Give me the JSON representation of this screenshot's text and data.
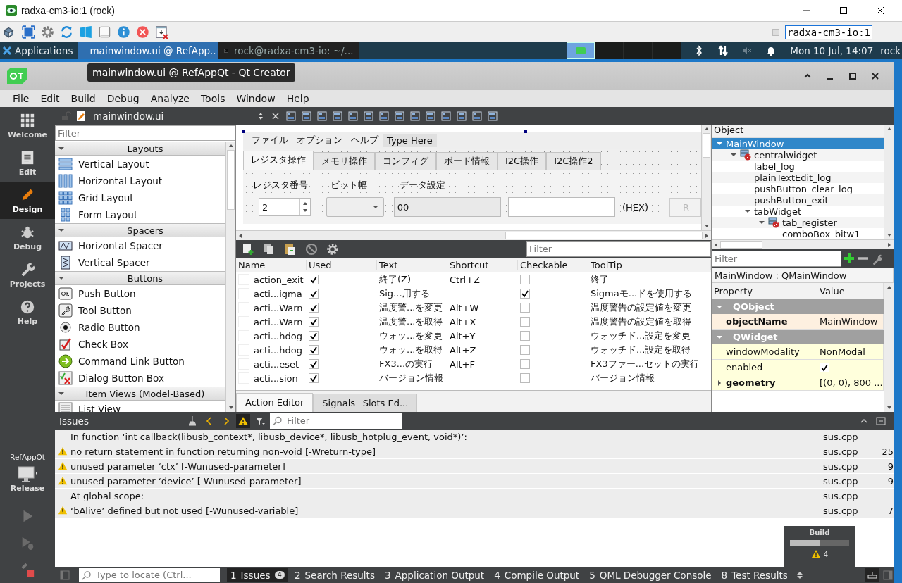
{
  "vnc": {
    "title": "radxa-cm3-io:1 (rock)",
    "host_field": "radxa-cm3-io:1"
  },
  "taskbar": {
    "applications": "Applications",
    "tasks": [
      {
        "label": "mainwindow.ui @ RefApp..",
        "kind": "qt",
        "selected": true
      },
      {
        "label": "rock@radxa-cm3-io: ~/...",
        "kind": "terminal",
        "selected": false
      }
    ],
    "clock": "Mon 10 Jul, 14:07",
    "user": "rock"
  },
  "tooltip": "mainwindow.ui @ RefAppQt - Qt Creator",
  "menu": [
    "File",
    "Edit",
    "Build",
    "Debug",
    "Analyze",
    "Tools",
    "Window",
    "Help"
  ],
  "modes": [
    {
      "label": "Welcome",
      "kind": "grid",
      "selected": false
    },
    {
      "label": "Edit",
      "kind": "doc",
      "selected": false
    },
    {
      "label": "Design",
      "kind": "pencil",
      "selected": true
    },
    {
      "label": "Debug",
      "kind": "bug",
      "selected": false
    },
    {
      "label": "Projects",
      "kind": "wrench",
      "selected": false
    },
    {
      "label": "Help",
      "kind": "help",
      "selected": false
    }
  ],
  "target": {
    "project": "RefAppQt",
    "config": "Release"
  },
  "editor": {
    "file": "mainwindow.ui"
  },
  "widget_box": {
    "placeholder": "Filter",
    "groups": [
      {
        "title": "Layouts",
        "items": [
          {
            "label": "Vertical Layout",
            "kind": "vlayout"
          },
          {
            "label": "Horizontal Layout",
            "kind": "hlayout"
          },
          {
            "label": "Grid Layout",
            "kind": "grid"
          },
          {
            "label": "Form Layout",
            "kind": "form"
          }
        ]
      },
      {
        "title": "Spacers",
        "items": [
          {
            "label": "Horizontal Spacer",
            "kind": "hspacer"
          },
          {
            "label": "Vertical Spacer",
            "kind": "vspacer"
          }
        ]
      },
      {
        "title": "Buttons",
        "items": [
          {
            "label": "Push Button",
            "kind": "push"
          },
          {
            "label": "Tool Button",
            "kind": "tool"
          },
          {
            "label": "Radio Button",
            "kind": "radio"
          },
          {
            "label": "Check Box",
            "kind": "check"
          },
          {
            "label": "Command Link Button",
            "kind": "command"
          },
          {
            "label": "Dialog Button Box",
            "kind": "dialog"
          }
        ]
      },
      {
        "title": "Item Views (Model-Based)",
        "items": [
          {
            "label": "List View",
            "kind": "list"
          }
        ]
      }
    ]
  },
  "form": {
    "menu": [
      {
        "label": "ファイル",
        "kind": "menu"
      },
      {
        "label": "オプション",
        "kind": "menu"
      },
      {
        "label": "ヘルプ",
        "kind": "menu"
      },
      {
        "label": "Type Here",
        "kind": "placeholder"
      }
    ],
    "tabs": [
      {
        "label": "レジスタ操作",
        "selected": true
      },
      {
        "label": "メモリ操作",
        "selected": false
      },
      {
        "label": "コンフィグ",
        "selected": false
      },
      {
        "label": "ボード情報",
        "selected": false
      },
      {
        "label": "I2C操作",
        "selected": false
      },
      {
        "label": "I2C操作2",
        "selected": false
      }
    ],
    "labels": [
      "レジスタ番号",
      "ビット幅",
      "データ設定"
    ],
    "spin_value": "2",
    "data_value": "00",
    "hex": "(HEX)",
    "button_label": "R"
  },
  "actions": {
    "placeholder": "Filter",
    "columns": [
      "Name",
      "Used",
      "Text",
      "Shortcut",
      "Checkable",
      "ToolTip"
    ],
    "rows": [
      {
        "name": "action_exit",
        "used": true,
        "text": "終了(Z)",
        "shortcut": "Ctrl+Z",
        "checkable": false,
        "tooltip": "終了"
      },
      {
        "name": "acti...igma",
        "used": true,
        "text": "Sig...用する",
        "checkable": true,
        "tooltip": "Sigmaモ...ドを使用する"
      },
      {
        "name": "acti...Warn",
        "used": true,
        "text": "温度警...を変更",
        "shortcut": "Alt+W",
        "checkable": false,
        "tooltip": "温度警告の設定値を変更"
      },
      {
        "name": "acti...Warn",
        "used": true,
        "text": "温度警...を取得",
        "shortcut": "Alt+X",
        "checkable": false,
        "tooltip": "温度警告の設定値を取得"
      },
      {
        "name": "acti...hdog",
        "used": true,
        "text": "ウォッ...を変更",
        "shortcut": "Alt+Y",
        "checkable": false,
        "tooltip": "ウォッチド...設定を変更"
      },
      {
        "name": "acti...hdog",
        "used": true,
        "text": "ウォッ...を取得",
        "shortcut": "Alt+Z",
        "checkable": false,
        "tooltip": "ウォッチド...設定を取得"
      },
      {
        "name": "acti...eset",
        "used": true,
        "text": "FX3...の実行",
        "shortcut": "Alt+F",
        "checkable": false,
        "tooltip": "FX3ファー...セットの実行"
      },
      {
        "name": "acti...sion",
        "used": true,
        "text": "バージョン情報",
        "checkable": false,
        "tooltip": "バージョン情報"
      }
    ],
    "tabs": [
      {
        "label": "Action Editor",
        "selected": true
      },
      {
        "label": "Signals _Slots Ed...",
        "selected": false
      }
    ]
  },
  "object_inspector": {
    "heading": "Object",
    "tree": [
      {
        "label": "MainWindow",
        "selected": true,
        "expanded": true,
        "children": [
          {
            "label": "centralwidget",
            "kind": "layout",
            "selected": false,
            "expanded": true,
            "children": [
              {
                "label": "label_log",
                "selected": false
              },
              {
                "label": "plainTextEdit_log",
                "selected": false
              },
              {
                "label": "pushButton_clear_log",
                "selected": false
              },
              {
                "label": "pushButton_exit",
                "selected": false
              },
              {
                "label": "tabWidget",
                "selected": false,
                "expanded": true,
                "children": [
                  {
                    "label": "tab_register",
                    "kind": "layout",
                    "selected": false,
                    "expanded": true,
                    "children": [
                      {
                        "label": "comboBox_bitw1",
                        "selected": false
                      }
                    ]
                  }
                ]
              }
            ]
          }
        ]
      }
    ]
  },
  "property_editor": {
    "placeholder": "Filter",
    "class": "MainWindow : QMainWindow",
    "columns": [
      "Property",
      "Value"
    ],
    "groups": [
      {
        "name": "QObject",
        "rows": [
          {
            "name": "objectName",
            "kind": "text",
            "value": "MainWindow",
            "modified": true,
            "expandable": false
          }
        ]
      },
      {
        "name": "QWidget",
        "rows": [
          {
            "name": "windowModality",
            "kind": "text",
            "value": "NonModal",
            "modified": false,
            "expandable": false
          },
          {
            "name": "enabled",
            "kind": "check",
            "checked": true,
            "modified": false,
            "expandable": false
          },
          {
            "name": "geometry",
            "kind": "text",
            "value": "[(0, 0), 800 ...",
            "modified": true,
            "expandable": true
          }
        ]
      }
    ]
  },
  "issues": {
    "title": "Issues",
    "placeholder": "Filter",
    "rows": [
      {
        "kind": "note",
        "text": "In function ‘int callback(libusb_context*, libusb_device*, libusb_hotplug_event, void*)’:",
        "file": "sus.cpp"
      },
      {
        "kind": "warning",
        "text": "no return statement in function returning non-void [-Wreturn-type]",
        "file": "sus.cpp",
        "line": "25"
      },
      {
        "kind": "warning",
        "text": "unused parameter ‘ctx’ [-Wunused-parameter]",
        "file": "sus.cpp",
        "line": "9"
      },
      {
        "kind": "warning",
        "text": "unused parameter ‘device’ [-Wunused-parameter]",
        "file": "sus.cpp",
        "line": "9"
      },
      {
        "kind": "note",
        "text": "At global scope:",
        "file": "sus.cpp"
      },
      {
        "kind": "warning",
        "text": "‘bAlive’ defined but not used [-Wunused-variable]",
        "file": "sus.cpp",
        "line": "7"
      }
    ]
  },
  "build": {
    "title": "Build",
    "level": 0.5,
    "warnings": "4"
  },
  "status": {
    "placeholder": "Type to locate (Ctrl...",
    "tabs": [
      {
        "number": "1",
        "label": "Issues",
        "badge": "4",
        "selected": true
      },
      {
        "number": "2",
        "label": "Search Results",
        "selected": false
      },
      {
        "number": "3",
        "label": "Application Output",
        "selected": false
      },
      {
        "number": "4",
        "label": "Compile Output",
        "selected": false
      },
      {
        "number": "5",
        "label": "QML Debugger Console",
        "selected": false
      },
      {
        "number": "8",
        "label": "Test Results",
        "selected": false
      }
    ]
  }
}
